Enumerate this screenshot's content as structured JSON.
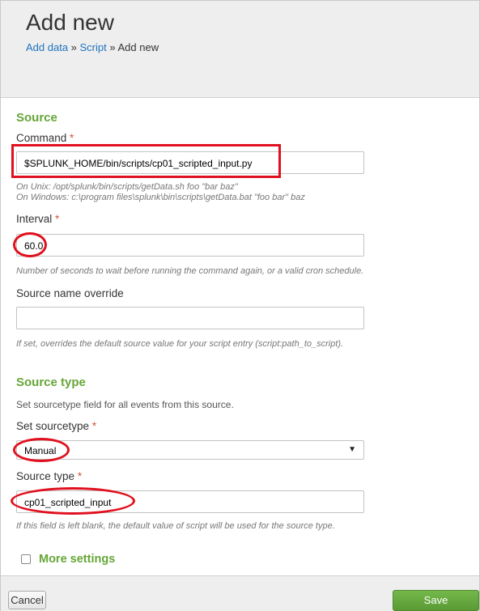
{
  "header": {
    "title": "Add new",
    "breadcrumb": {
      "item1": "Add data",
      "sep1": " » ",
      "item2": "Script",
      "sep2": " » ",
      "current": "Add new"
    }
  },
  "source": {
    "title": "Source",
    "command_label": "Command",
    "command_value": "$SPLUNK_HOME/bin/scripts/cp01_scripted_input.py",
    "command_help_unix": "On Unix: /opt/splunk/bin/scripts/getData.sh foo \"bar baz\"",
    "command_help_windows": "On Windows: c:\\program files\\splunk\\bin\\scripts\\getData.bat \"foo bar\" baz",
    "interval_label": "Interval",
    "interval_value": "60.0",
    "interval_help": "Number of seconds to wait before running the command again, or a valid cron schedule.",
    "source_name_label": "Source name override",
    "source_name_value": "",
    "source_name_help": "If set, overrides the default source value for your script entry (script:path_to_script)."
  },
  "source_type": {
    "title": "Source type",
    "description": "Set sourcetype field for all events from this source.",
    "set_sourcetype_label": "Set sourcetype",
    "set_sourcetype_value": "Manual",
    "source_type_label": "Source type",
    "source_type_value": "cp01_scripted_input",
    "source_type_help": "If this field is left blank, the default value of script will be used for the source type."
  },
  "required_marker": "*",
  "more_settings": {
    "label": "More settings",
    "checked": false
  },
  "footer": {
    "cancel_label": "Cancel",
    "save_label": "Save"
  },
  "colors": {
    "accent_green": "#65a637",
    "annotation_red": "#e0101e",
    "link_blue": "#1e73be",
    "save_green": "#5a9a35"
  }
}
